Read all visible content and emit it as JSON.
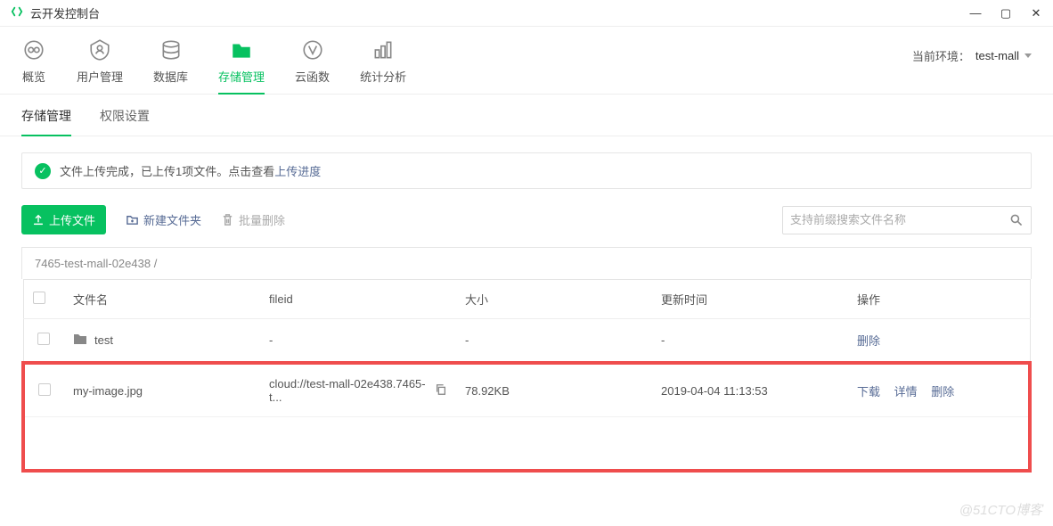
{
  "titlebar": {
    "title": "云开发控制台"
  },
  "nav": {
    "items": [
      {
        "label": "概览"
      },
      {
        "label": "用户管理"
      },
      {
        "label": "数据库"
      },
      {
        "label": "存储管理"
      },
      {
        "label": "云函数"
      },
      {
        "label": "统计分析"
      }
    ],
    "env_label": "当前环境：",
    "env_name": "test-mall"
  },
  "subtabs": {
    "items": [
      "存储管理",
      "权限设置"
    ]
  },
  "alert": {
    "text": "文件上传完成，已上传1项文件。点击查看",
    "link": "上传进度"
  },
  "toolbar": {
    "upload": "上传文件",
    "newfolder": "新建文件夹",
    "batchdelete": "批量删除",
    "search_placeholder": "支持前缀搜索文件名称"
  },
  "breadcrumb": "7465-test-mall-02e438  /",
  "table": {
    "headers": {
      "name": "文件名",
      "fileid": "fileid",
      "size": "大小",
      "time": "更新时间",
      "actions": "操作"
    },
    "rows": [
      {
        "type": "folder",
        "name": "test",
        "fileid": "-",
        "size": "-",
        "time": "-",
        "actions": [
          "删除"
        ]
      },
      {
        "type": "file",
        "name": "my-image.jpg",
        "fileid": "cloud://test-mall-02e438.7465-t...",
        "size": "78.92KB",
        "time": "2019-04-04 11:13:53",
        "actions": [
          "下载",
          "详情",
          "删除"
        ]
      }
    ]
  },
  "watermark": "@51CTO博客"
}
